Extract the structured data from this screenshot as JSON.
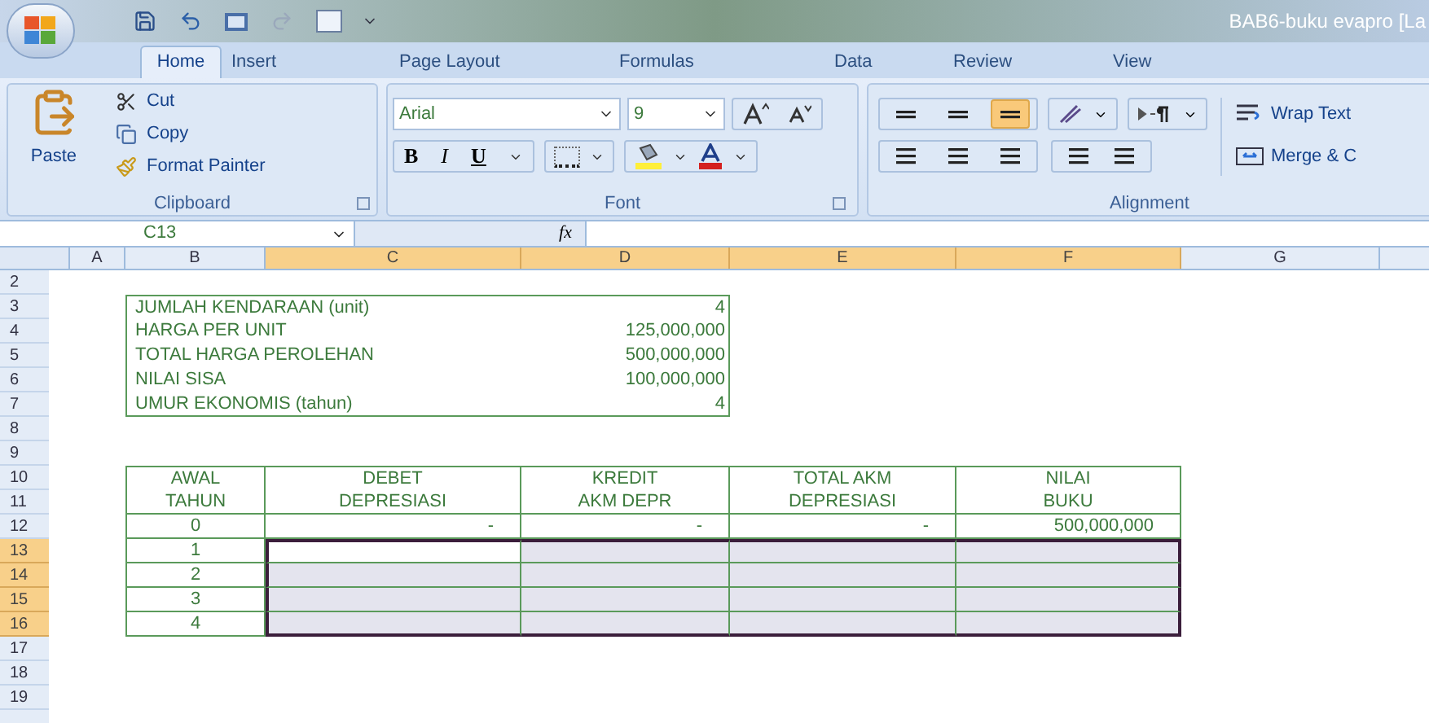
{
  "window": {
    "title": "BAB6-buku evapro [La"
  },
  "tabs": [
    {
      "label": "Home",
      "selected": true
    },
    {
      "label": "Insert",
      "selected": false
    },
    {
      "label": "Page Layout",
      "selected": false
    },
    {
      "label": "Formulas",
      "selected": false
    },
    {
      "label": "Data",
      "selected": false
    },
    {
      "label": "Review",
      "selected": false
    },
    {
      "label": "View",
      "selected": false
    }
  ],
  "clipboard": {
    "label": "Clipboard",
    "paste": "Paste",
    "cut": "Cut",
    "copy": "Copy",
    "format_painter": "Format Painter"
  },
  "font": {
    "label": "Font",
    "name": "Arial",
    "size": "9",
    "bold": "B",
    "italic": "I",
    "underline": "U"
  },
  "alignment": {
    "label": "Alignment",
    "vertical": [
      {
        "selected": false
      },
      {
        "selected": false
      },
      {
        "selected": true
      }
    ],
    "wrap_text": "Wrap Text",
    "merge": "Merge & C"
  },
  "formula_bar": {
    "name_box": "C13",
    "function_label": "fx"
  },
  "columns": [
    {
      "label": "A",
      "selected": false
    },
    {
      "label": "B",
      "selected": false
    },
    {
      "label": "C",
      "selected": true
    },
    {
      "label": "D",
      "selected": true
    },
    {
      "label": "E",
      "selected": true
    },
    {
      "label": "F",
      "selected": true
    },
    {
      "label": "G",
      "selected": false
    }
  ],
  "row_numbers": [
    {
      "label": "2",
      "selected": false
    },
    {
      "label": "3",
      "selected": false
    },
    {
      "label": "4",
      "selected": false
    },
    {
      "label": "5",
      "selected": false
    },
    {
      "label": "6",
      "selected": false
    },
    {
      "label": "7",
      "selected": false
    },
    {
      "label": "8",
      "selected": false
    },
    {
      "label": "9",
      "selected": false
    },
    {
      "label": "10",
      "selected": false
    },
    {
      "label": "11",
      "selected": false
    },
    {
      "label": "12",
      "selected": false
    },
    {
      "label": "13",
      "selected": true
    },
    {
      "label": "14",
      "selected": true
    },
    {
      "label": "15",
      "selected": true
    },
    {
      "label": "16",
      "selected": true
    },
    {
      "label": "17",
      "selected": false
    },
    {
      "label": "18",
      "selected": false
    },
    {
      "label": "19",
      "selected": false
    }
  ],
  "info": [
    {
      "label": "JUMLAH KENDARAAN (unit)",
      "value": "4"
    },
    {
      "label": "HARGA PER UNIT",
      "value": "125,000,000"
    },
    {
      "label": "TOTAL HARGA PEROLEHAN",
      "value": "500,000,000"
    },
    {
      "label": "NILAI SISA",
      "value": "100,000,000"
    },
    {
      "label": "UMUR EKONOMIS (tahun)",
      "value": "4"
    }
  ],
  "table": {
    "headers": [
      {
        "line1": "AWAL",
        "line2": "TAHUN"
      },
      {
        "line1": "DEBET",
        "line2": "DEPRESIASI"
      },
      {
        "line1": "KREDIT",
        "line2": "AKM DEPR"
      },
      {
        "line1": "TOTAL AKM",
        "line2": "DEPRESIASI"
      },
      {
        "line1": "NILAI",
        "line2": "BUKU"
      }
    ],
    "rows": [
      {
        "year": "0",
        "values": [
          "-",
          "-",
          "-",
          "500,000,000"
        ],
        "selected": false
      },
      {
        "year": "1",
        "selected": true
      },
      {
        "year": "2",
        "selected": true
      },
      {
        "year": "3",
        "selected": true
      },
      {
        "year": "4",
        "selected": true
      }
    ]
  }
}
